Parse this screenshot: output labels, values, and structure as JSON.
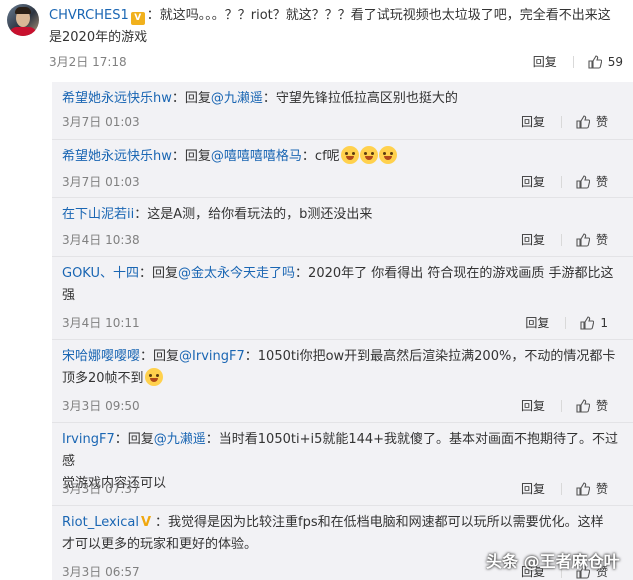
{
  "top_comment": {
    "username": "CHVRCHES1",
    "text_line1": "：就这吗。。。？？riot？就这？？？看了试玩视频也太垃圾了吧，完全看不出来这",
    "text_line2": "是2020年的游戏",
    "time": "3月2日 17:18",
    "reply_label": "回复",
    "likes": "59"
  },
  "replies": [
    {
      "user": "希望她永远快乐hw",
      "sep": "：",
      "reply_prefix": "回复",
      "mention": "@九濑遥",
      "text": "：守望先锋拉低拉高区别也挺大的",
      "time": "3月7日 01:03",
      "reply_label": "回复",
      "likes": "赞"
    },
    {
      "user": "希望她永远快乐hw",
      "sep": "：",
      "reply_prefix": "回复",
      "mention": "@嘻嘻嘻嘻格马",
      "text": "：cf呢",
      "time": "3月7日 01:03",
      "reply_label": "回复",
      "likes": "赞"
    },
    {
      "user": "在下山泥若ii",
      "sep": "：",
      "text": "这是A测，给你看玩法的，b测还没出来",
      "time": "3月4日 10:38",
      "reply_label": "回复",
      "likes": "赞"
    },
    {
      "user": "GOKU、十四",
      "sep": "：",
      "reply_prefix": "回复",
      "mention": "@金太永今天走了吗",
      "text": "：2020年了 你看得出 符合现在的游戏画质 手游都比这",
      "text2": "强",
      "time": "3月4日 10:11",
      "reply_label": "回复",
      "likes": "1"
    },
    {
      "user": "宋哈娜嘤嘤嘤",
      "sep": "：",
      "reply_prefix": "回复",
      "mention": "@IrvingF7",
      "text": "：1050ti你把ow开到最高然后渲染拉满200%，不动的情况都卡",
      "text2": "顶多20帧不到",
      "time": "3月3日 09:50",
      "reply_label": "回复",
      "likes": "赞"
    },
    {
      "user": "IrvingF7",
      "sep": "：",
      "reply_prefix": "回复",
      "mention": "@九濑遥",
      "text": "：当时看1050ti+i5就能144+我就傻了。基本对画面不抱期待了。不过感",
      "text2": "觉游戏内容还可以",
      "time": "3月3日 07:37",
      "reply_label": "回复",
      "likes": "赞"
    },
    {
      "user": "Riot_Lexical",
      "sep": "：",
      "text": "我觉得是因为比较注重fps和在低档电脑和网速都可以玩所以需要优化。这样",
      "text2": "才可以更多的玩家和更好的体验。",
      "time": "3月3日 06:57",
      "reply_label": "回复",
      "likes": "赞"
    }
  ],
  "watermark": "头条 @王者麻仓叶",
  "colors": {
    "link": "#1a66b3",
    "accent": "#eb7350",
    "reply_bg": "#f2f2f5"
  }
}
